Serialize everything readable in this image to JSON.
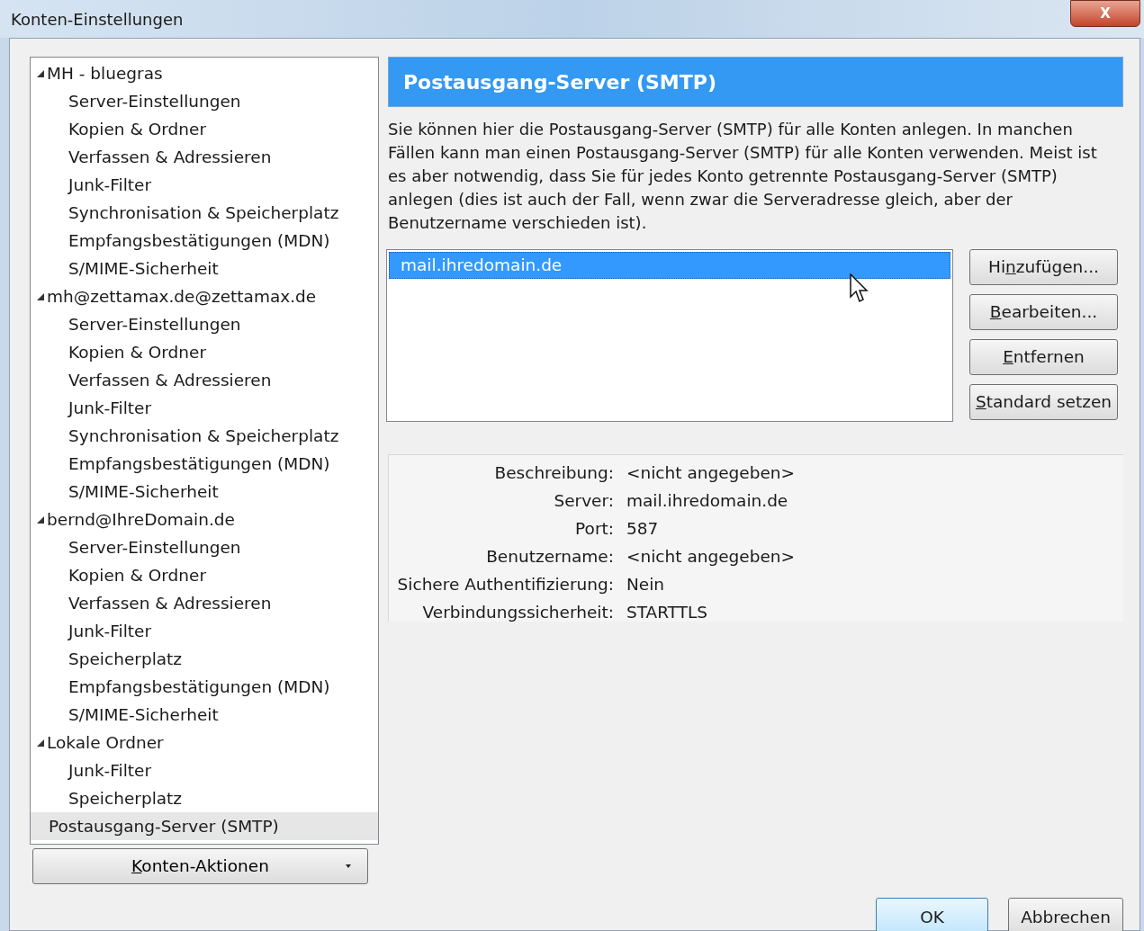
{
  "window": {
    "title": "Konten-Einstellungen",
    "close_button": "X"
  },
  "tree": [
    {
      "label": "MH - bluegras",
      "expanded": true,
      "selected": false,
      "children": [
        {
          "label": "Server-Einstellungen",
          "selected": false
        },
        {
          "label": "Kopien & Ordner",
          "selected": false
        },
        {
          "label": "Verfassen & Adressieren",
          "selected": false
        },
        {
          "label": "Junk-Filter",
          "selected": false
        },
        {
          "label": "Synchronisation & Speicherplatz",
          "selected": false
        },
        {
          "label": "Empfangsbestätigungen (MDN)",
          "selected": false
        },
        {
          "label": "S/MIME-Sicherheit",
          "selected": false
        }
      ]
    },
    {
      "label": "mh@zettamax.de@zettamax.de",
      "expanded": true,
      "selected": false,
      "children": [
        {
          "label": "Server-Einstellungen",
          "selected": false
        },
        {
          "label": "Kopien & Ordner",
          "selected": false
        },
        {
          "label": "Verfassen & Adressieren",
          "selected": false
        },
        {
          "label": "Junk-Filter",
          "selected": false
        },
        {
          "label": "Synchronisation & Speicherplatz",
          "selected": false
        },
        {
          "label": "Empfangsbestätigungen (MDN)",
          "selected": false
        },
        {
          "label": "S/MIME-Sicherheit",
          "selected": false
        }
      ]
    },
    {
      "label": "bernd@IhreDomain.de",
      "expanded": true,
      "selected": false,
      "children": [
        {
          "label": "Server-Einstellungen",
          "selected": false
        },
        {
          "label": "Kopien & Ordner",
          "selected": false
        },
        {
          "label": "Verfassen & Adressieren",
          "selected": false
        },
        {
          "label": "Junk-Filter",
          "selected": false
        },
        {
          "label": "Speicherplatz",
          "selected": false
        },
        {
          "label": "Empfangsbestätigungen (MDN)",
          "selected": false
        },
        {
          "label": "S/MIME-Sicherheit",
          "selected": false
        }
      ]
    },
    {
      "label": "Lokale Ordner",
      "expanded": true,
      "selected": false,
      "children": [
        {
          "label": "Junk-Filter",
          "selected": false
        },
        {
          "label": "Speicherplatz",
          "selected": false
        }
      ]
    },
    {
      "label": "Postausgang-Server (SMTP)",
      "selected": true
    }
  ],
  "account_actions": {
    "label": [
      {
        "text": "K",
        "underlined": true
      },
      {
        "text": "onten-Aktionen",
        "underlined": false
      }
    ]
  },
  "panel": {
    "title": "Postausgang-Server (SMTP)",
    "description": "Sie können hier die Postausgang-Server (SMTP) für alle Konten anlegen. In manchen Fällen kann man einen Postausgang-Server (SMTP) für alle Konten verwenden. Meist ist es aber notwendig, dass Sie für jedes Konto getrennte Postausgang-Server (SMTP) anlegen (dies ist auch der Fall, wenn zwar die Serveradresse gleich, aber der Benutzername verschieden ist).",
    "servers": [
      {
        "label": "mail.ihredomain.de",
        "selected": true
      }
    ],
    "buttons": [
      {
        "label": [
          {
            "text": "Hi",
            "underlined": false
          },
          {
            "text": "n",
            "underlined": true
          },
          {
            "text": "zufügen...",
            "underlined": false
          }
        ]
      },
      {
        "label": [
          {
            "text": "B",
            "underlined": true
          },
          {
            "text": "earbeiten...",
            "underlined": false
          }
        ]
      },
      {
        "label": [
          {
            "text": "E",
            "underlined": true
          },
          {
            "text": "ntfernen",
            "underlined": false
          }
        ]
      },
      {
        "label": [
          {
            "text": "S",
            "underlined": true
          },
          {
            "text": "tandard setzen",
            "underlined": false
          }
        ]
      }
    ],
    "details": [
      {
        "label": "Beschreibung:",
        "value": "<nicht angegeben>"
      },
      {
        "label": "Server:",
        "value": "mail.ihredomain.de"
      },
      {
        "label": "Port:",
        "value": "587"
      },
      {
        "label": "Benutzername:",
        "value": "<nicht angegeben>"
      },
      {
        "label": "Sichere Authentifizierung:",
        "value": "Nein"
      },
      {
        "label": "Verbindungssicherheit:",
        "value": "STARTTLS"
      }
    ]
  },
  "dialog_buttons": [
    {
      "label": "OK"
    },
    {
      "label": "Abbrechen"
    }
  ]
}
